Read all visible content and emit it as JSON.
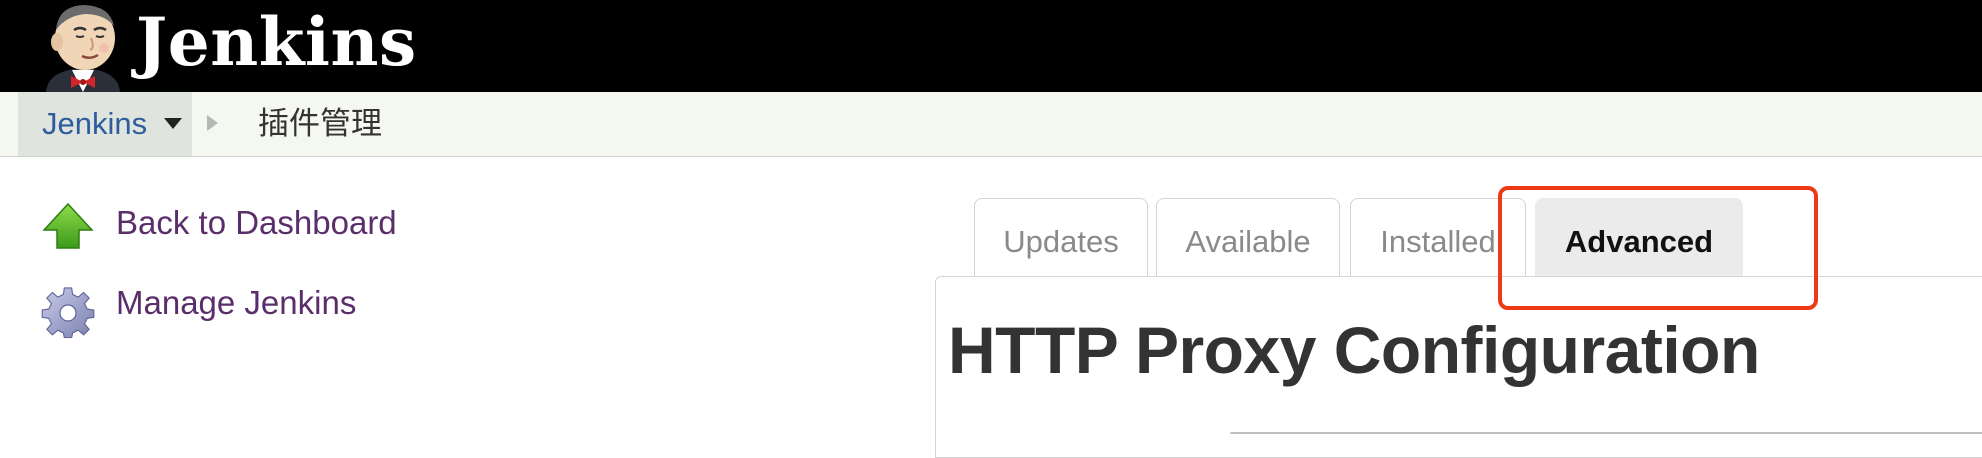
{
  "header": {
    "logo_text": "Jenkins",
    "logo_icon": "jenkins-butler-logo"
  },
  "breadcrumb": {
    "root": "Jenkins",
    "current": "插件管理"
  },
  "side_panel": {
    "tasks": [
      {
        "label": "Back to Dashboard",
        "icon": "up-arrow-icon"
      },
      {
        "label": "Manage Jenkins",
        "icon": "gear-icon"
      }
    ]
  },
  "tabs": [
    {
      "label": "Updates",
      "active": false
    },
    {
      "label": "Available",
      "active": false
    },
    {
      "label": "Installed",
      "active": false
    },
    {
      "label": "Advanced",
      "active": true
    }
  ],
  "main": {
    "heading": "HTTP Proxy Configuration"
  },
  "colors": {
    "header_bg": "#000000",
    "link": "#2e5c9e",
    "side_link": "#5a2d6b",
    "highlight": "#ee3a14"
  }
}
